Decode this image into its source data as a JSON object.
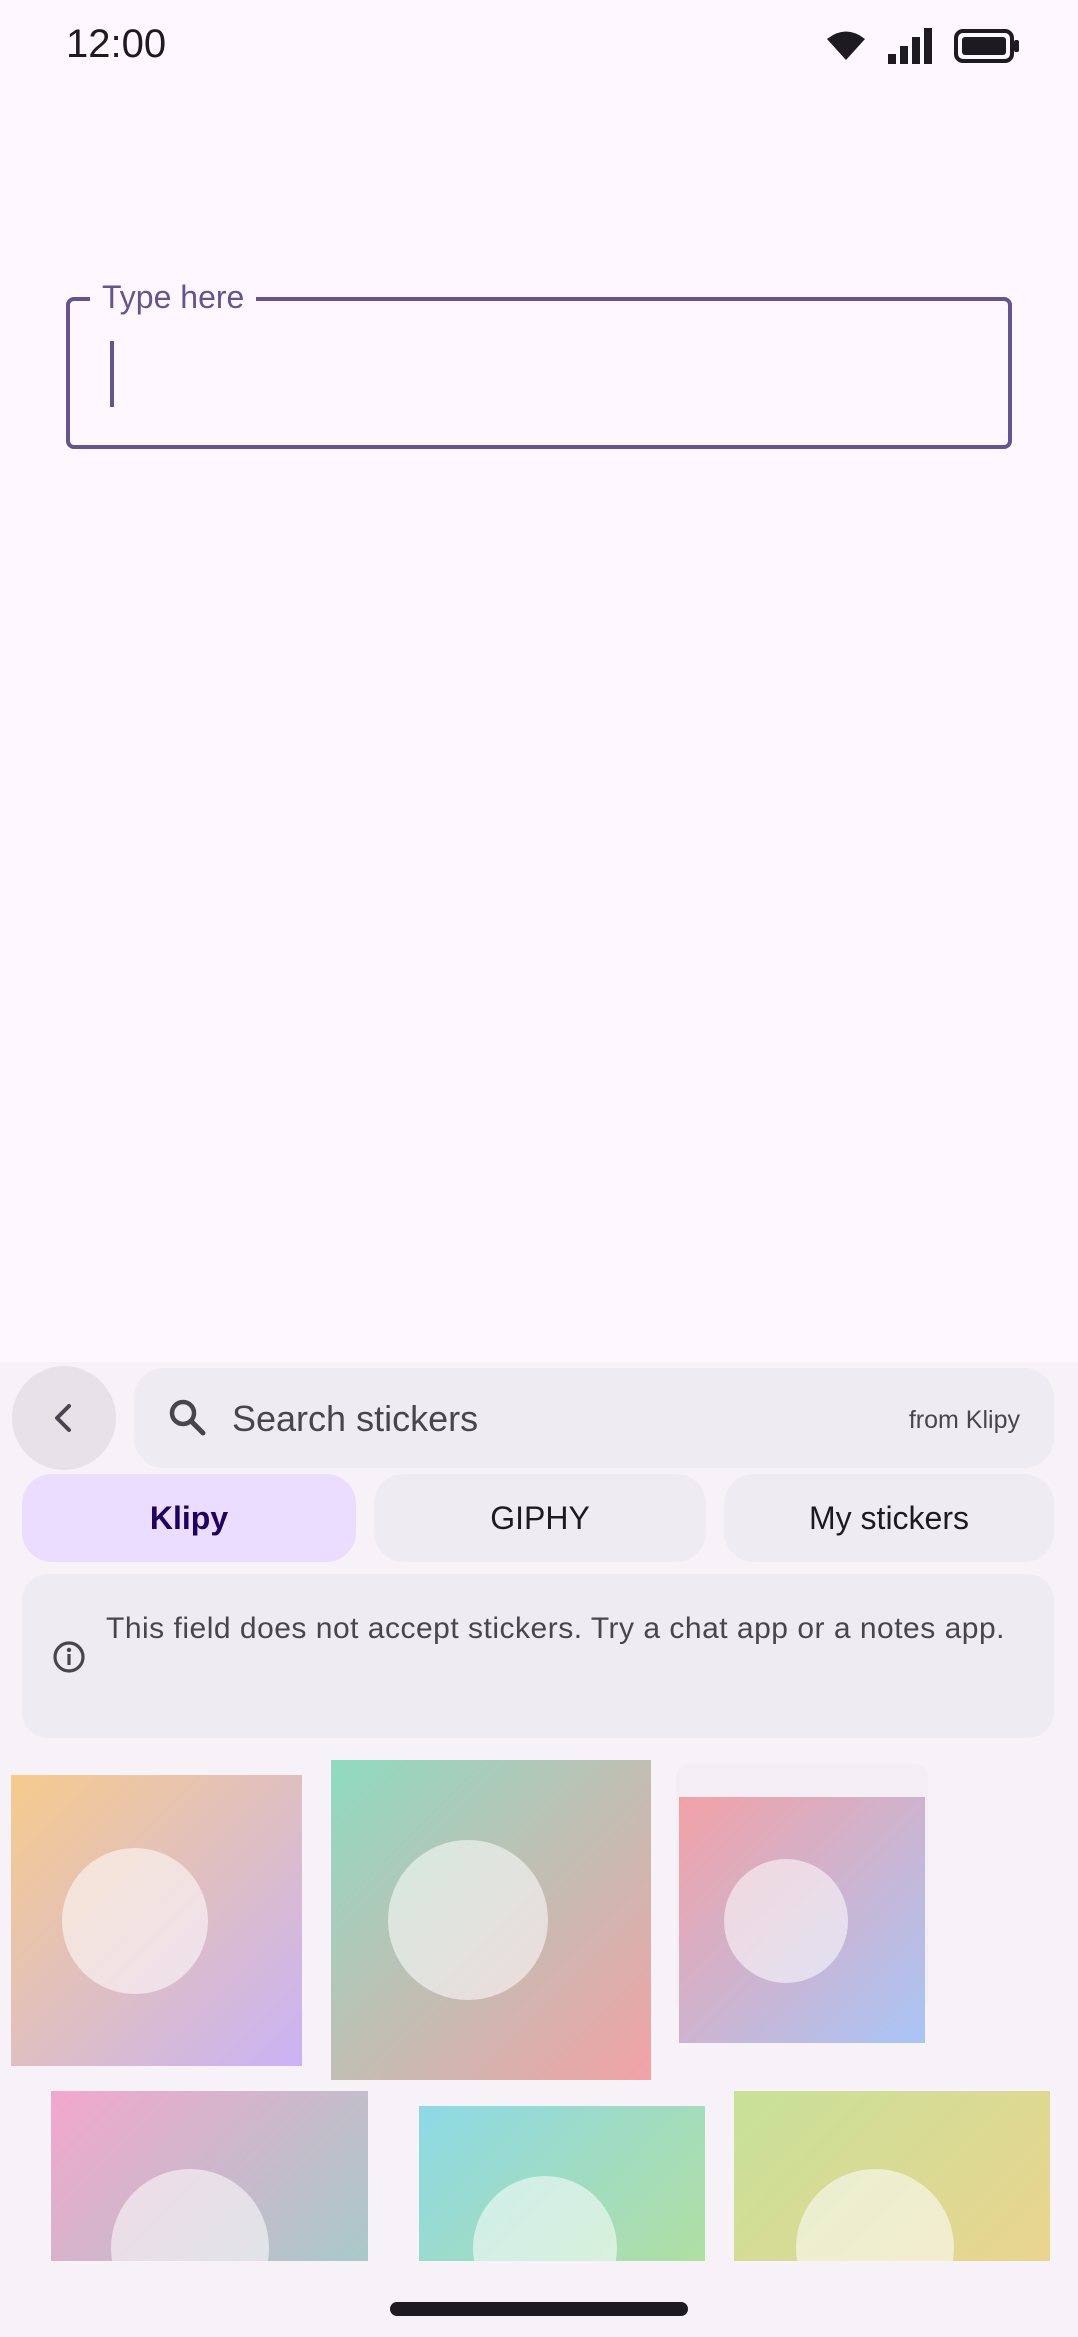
{
  "status_bar": {
    "time": "12:00",
    "icons": [
      "wifi-icon",
      "signal-icon",
      "battery-icon"
    ]
  },
  "text_field": {
    "label": "Type here",
    "value": ""
  },
  "sticker_panel": {
    "back_icon": "chevron-left-icon",
    "search": {
      "placeholder": "Search stickers",
      "source": "from Klipy",
      "icon": "search-icon"
    },
    "tabs": [
      {
        "label": "Klipy",
        "selected": true
      },
      {
        "label": "GIPHY",
        "selected": false
      },
      {
        "label": "My stickers",
        "selected": false
      }
    ],
    "info": {
      "icon": "info-icon",
      "text": "This field does not accept stickers. Try a chat app or a notes app."
    },
    "stickers": [
      {
        "gradient": [
          "#f6cb8d",
          "#c9b3f5"
        ]
      },
      {
        "gradient": [
          "#8fdbc1",
          "#f2a2a6"
        ]
      },
      {
        "gradient": [
          "#f2a2a6",
          "#a9c5f7"
        ]
      },
      {
        "gradient": [
          "#f2a7cd",
          "#a9c9c9"
        ]
      },
      {
        "gradient": [
          "#8dd9e6",
          "#b0dfa2"
        ]
      },
      {
        "gradient": [
          "#c7e199",
          "#ead48f"
        ]
      }
    ]
  },
  "colors": {
    "primary": "#65558f",
    "background": "#fdf7fe",
    "panel": "#f6f2f8",
    "tab_active": "#eaddff"
  }
}
